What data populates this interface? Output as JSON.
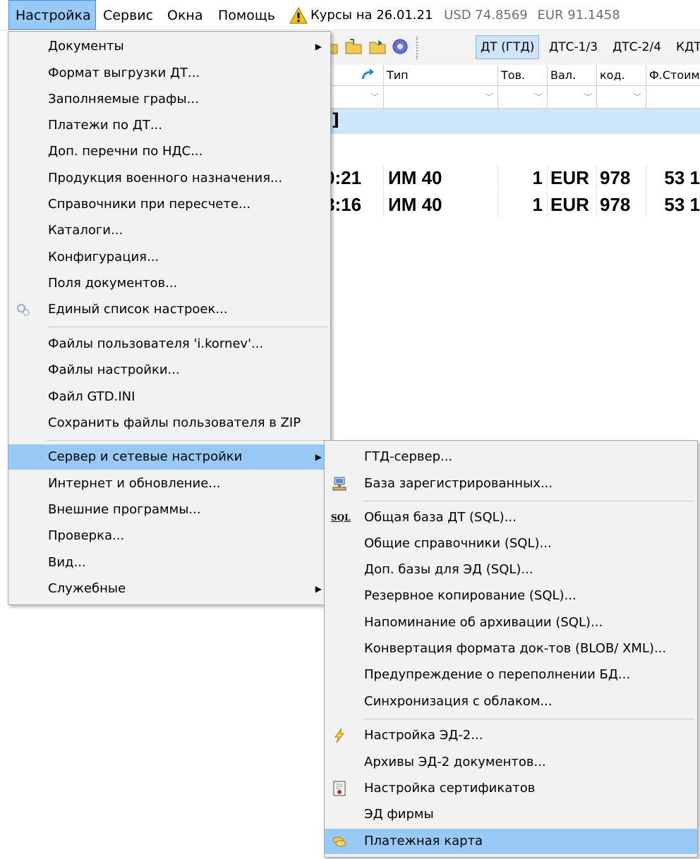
{
  "menubar": {
    "items": [
      "Настройка",
      "Сервис",
      "Окна",
      "Помощь"
    ],
    "rates": {
      "label": "Курсы на",
      "date": "26.01.21",
      "usd": "USD 74.8569",
      "eur": "EUR 91.1458"
    }
  },
  "toolbar": {
    "tabs": [
      "ДТ (ГТД)",
      "ДТС-1/3",
      "ДТС-2/4",
      "КДТ"
    ]
  },
  "grid": {
    "columns": [
      "Тип",
      "Тов.",
      "Вал.",
      "код.",
      "Ф.Стоим"
    ],
    "selected_fragment": "]",
    "rows": [
      {
        "time": "0:21",
        "type": "ИМ 40",
        "qty": "1",
        "cur": "EUR",
        "code": "978",
        "cost": "53 1"
      },
      {
        "time": "3:16",
        "type": "ИМ 40",
        "qty": "1",
        "cur": "EUR",
        "code": "978",
        "cost": "53 1"
      }
    ]
  },
  "main_menu": {
    "items": [
      "Документы",
      "Формат выгрузки ДТ...",
      "Заполняемые графы...",
      "Платежи по ДТ...",
      "Доп. перечни по НДС...",
      "Продукция военного назначения...",
      "Справочники при пересчете...",
      "Каталоги...",
      "Конфигурация...",
      "Поля документов...",
      "Единый список настроек...",
      "Файлы пользователя 'i.kornev'...",
      "Файлы настройки...",
      "Файл GTD.INI",
      "Сохранить файлы пользователя в ZIP",
      "Сервер и сетевые настройки",
      "Интернет и обновление...",
      "Внешние программы...",
      "Проверка...",
      "Вид...",
      "Служебные"
    ]
  },
  "sub_menu": {
    "items": [
      "ГТД-сервер...",
      "База зарегистрированных...",
      "Общая база ДТ (SQL)...",
      "Общие справочники (SQL)...",
      "Доп. базы для ЭД (SQL)...",
      "Резервное копирование (SQL)...",
      "Напоминание об архивации (SQL)...",
      "Конвертация формата док-тов (BLOB/ XML)...",
      "Предупреждение о переполнении БД...",
      "Синхронизация с облаком...",
      "Настройка ЭД-2...",
      "Архивы ЭД-2 документов...",
      "Настройка сертификатов",
      "ЭД фирмы",
      "Платежная карта"
    ],
    "sql_icon_text": "SQL"
  },
  "colors": {
    "highlight": "#99c9f5",
    "selected_row": "#cde6fb",
    "menu_bg": "#f2f2f2"
  }
}
